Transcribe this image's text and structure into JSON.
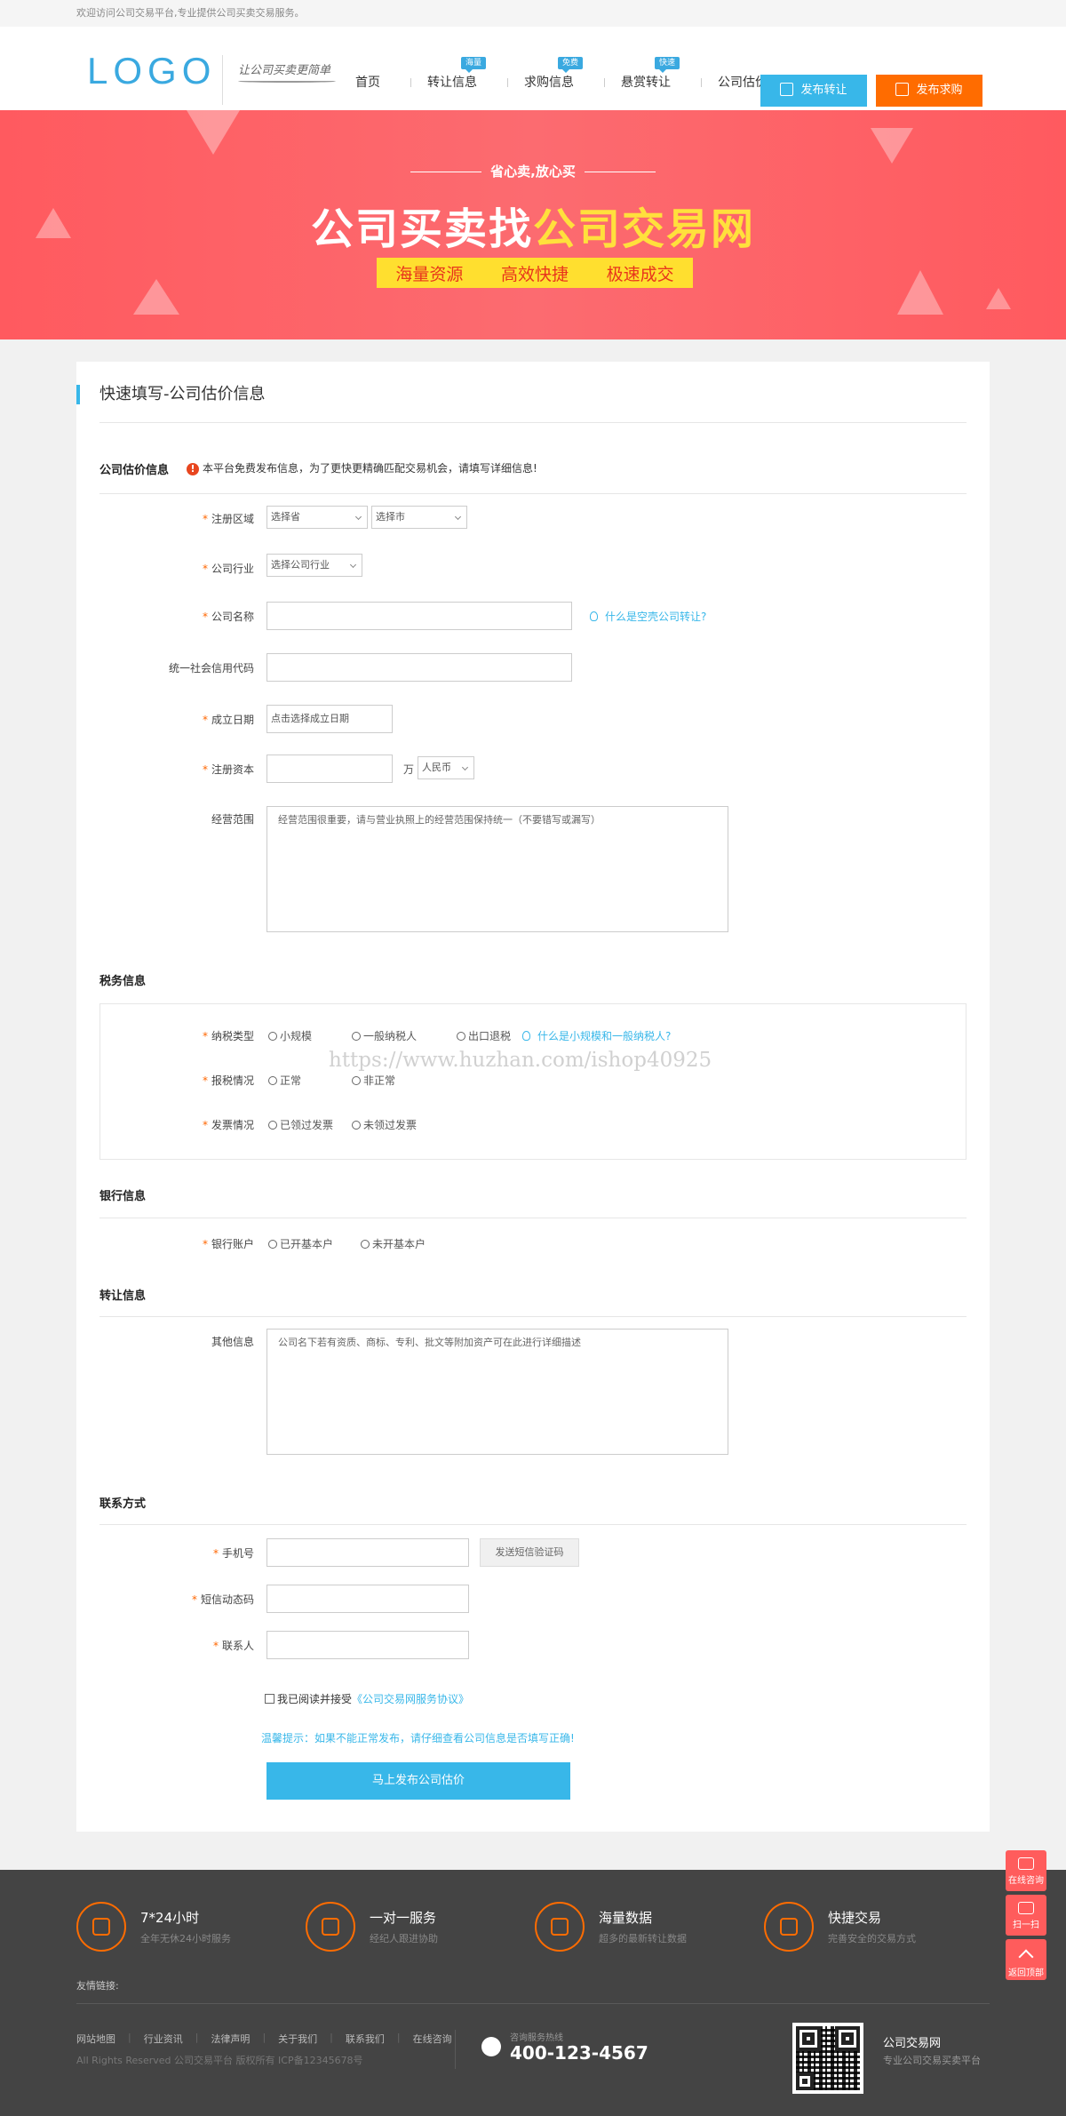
{
  "topbar": {
    "text": "欢迎访问公司交易平台,专业提供公司买卖交易服务。"
  },
  "header": {
    "logo": "LOGO",
    "slogan": "让公司买卖更简单",
    "nav": [
      {
        "label": "首页",
        "badge": ""
      },
      {
        "label": "转让信息",
        "badge": "海量"
      },
      {
        "label": "求购信息",
        "badge": "免费"
      },
      {
        "label": "悬赏转让",
        "badge": "快速"
      },
      {
        "label": "公司估价",
        "badge": ""
      }
    ],
    "btn_publish_transfer": "发布转让",
    "btn_publish_buy": "发布求购"
  },
  "banner": {
    "subtitle": "省心卖,放心买",
    "title_white": "公司买卖找",
    "title_yellow": "公司交易网",
    "tags": [
      "海量资源",
      "高效快捷",
      "极速成交"
    ]
  },
  "form": {
    "page_title": "快速填写-公司估价信息",
    "section_company": "公司估价信息",
    "notice": "本平台免费发布信息，为了更快更精确匹配交易机会，请填写详细信息!",
    "region_label": "注册区域",
    "province_placeholder": "选择省",
    "city_placeholder": "选择市",
    "industry_label": "公司行业",
    "industry_placeholder": "选择公司行业",
    "name_label": "公司名称",
    "name_hint": "什么是空壳公司转让?",
    "credit_label": "统一社会信用代码",
    "date_label": "成立日期",
    "date_placeholder": "点击选择成立日期",
    "capital_label": "注册资本",
    "capital_unit": "万",
    "currency": "人民币",
    "scope_label": "经营范围",
    "scope_placeholder": "经营范围很重要，请与营业执照上的经营范围保持统一（不要错写或漏写）",
    "section_tax": "税务信息",
    "tax_type_label": "纳税类型",
    "tax_types": [
      "小规模",
      "一般纳税人",
      "出口退税"
    ],
    "tax_hint": "什么是小规模和一般纳税人?",
    "report_label": "报税情况",
    "report_options": [
      "正常",
      "非正常"
    ],
    "invoice_label": "发票情况",
    "invoice_options": [
      "已领过发票",
      "未领过发票"
    ],
    "section_bank": "银行信息",
    "bank_label": "银行账户",
    "bank_options": [
      "已开基本户",
      "未开基本户"
    ],
    "section_transfer": "转让信息",
    "other_label": "其他信息",
    "other_placeholder": "公司名下若有资质、商标、专利、批文等附加资产可在此进行详细描述",
    "section_contact": "联系方式",
    "phone_label": "手机号",
    "sms_button": "发送短信验证码",
    "sms_label": "短信动态码",
    "contact_label": "联系人",
    "agree_text": "我已阅读并接受",
    "agree_link": "《公司交易网服务协议》",
    "tip": "温馨提示：如果不能正常发布，请仔细查看公司信息是否填写正确!",
    "submit": "马上发布公司估价"
  },
  "watermark": "https://www.huzhan.com/ishop40925",
  "footer": {
    "features": [
      {
        "title": "7*24小时",
        "desc": "全年无休24小时服务"
      },
      {
        "title": "一对一服务",
        "desc": "经纪人跟进协助"
      },
      {
        "title": "海量数据",
        "desc": "超多的最新转让数据"
      },
      {
        "title": "快捷交易",
        "desc": "完善安全的交易方式"
      }
    ],
    "links_label": "友情链接:",
    "nav": [
      "网站地图",
      "行业资讯",
      "法律声明",
      "关于我们",
      "联系我们",
      "在线咨询"
    ],
    "copyright": "All Rights Reserved 公司交易平台 版权所有 ICP备12345678号",
    "hotline_label": "咨询服务热线",
    "hotline": "400-123-4567",
    "brand": "公司交易网",
    "brand_desc": "专业公司交易买卖平台"
  },
  "sidebar": [
    "在线咨询",
    "扫一扫",
    "返回顶部"
  ]
}
